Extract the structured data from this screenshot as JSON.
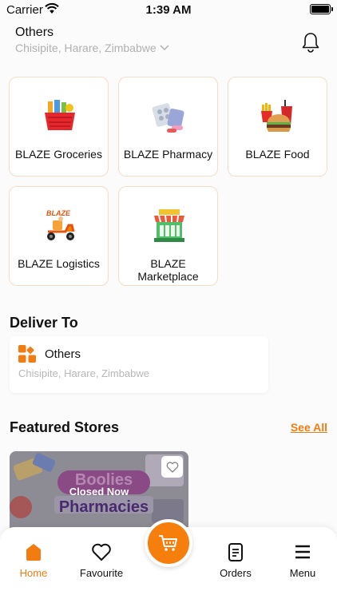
{
  "status": {
    "carrier": "Carrier",
    "time": "1:39 AM"
  },
  "header": {
    "location_label": "Others",
    "address": "Chisipite, Harare, Zimbabwe"
  },
  "services": [
    {
      "label": "BLAZE Groceries",
      "icon": "groceries-basket-icon"
    },
    {
      "label": "BLAZE Pharmacy",
      "icon": "pharmacy-pills-icon"
    },
    {
      "label": "BLAZE Food",
      "icon": "burger-food-icon"
    },
    {
      "label": "BLAZE Logistics",
      "icon": "delivery-scooter-icon"
    },
    {
      "label": "BLAZE Marketplace",
      "icon": "market-stall-icon"
    }
  ],
  "deliver": {
    "title": "Deliver To",
    "label": "Others",
    "address": "Chisipite, Harare, Zimbabwe"
  },
  "featured": {
    "title": "Featured Stores",
    "see_all": "See All",
    "store": {
      "name_line1": "Boolies",
      "name_line2": "Pharmacies",
      "status": "Closed Now"
    }
  },
  "nav": {
    "home": "Home",
    "favourite": "Favourite",
    "orders": "Orders",
    "menu": "Menu"
  },
  "colors": {
    "accent": "#f27b12",
    "accent_dark": "#e5550e"
  }
}
